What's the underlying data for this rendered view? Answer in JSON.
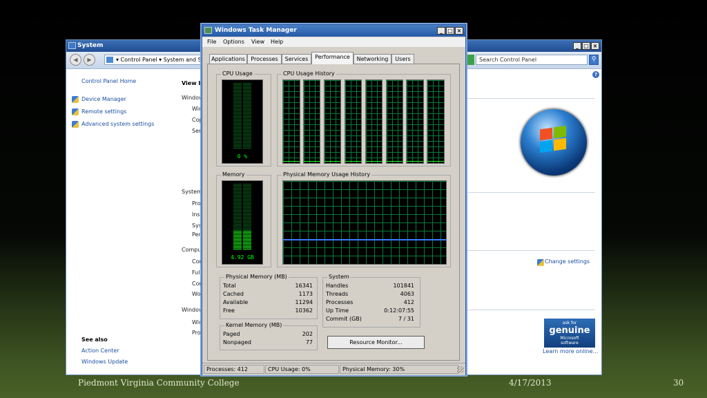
{
  "system_window": {
    "title": "System",
    "breadcrumb": "▾ Control Panel ▾ System and Se",
    "search_placeholder": "Search Control Panel",
    "sidebar": {
      "home": "Control Panel Home",
      "links": [
        "Device Manager",
        "Remote settings",
        "Advanced system settings"
      ],
      "see_also": "See also",
      "see_also_links": [
        "Action Center",
        "Windows Update"
      ]
    },
    "content": {
      "view_basic": "View ba",
      "windows_edition": "Windows",
      "edition_rows": [
        "Win",
        "Cop",
        "Serv"
      ],
      "system_section": "System",
      "system_rows": [
        "Proc",
        "Inst",
        "Syst",
        "Pen"
      ],
      "computer_section": "Compute",
      "computer_rows": [
        "Com",
        "Full",
        "Com",
        "Wor"
      ],
      "activation_section": "Windows",
      "activation_rows": [
        "Win",
        "Proc"
      ]
    },
    "change_settings": "Change settings",
    "genuine": {
      "ask": "ask for",
      "big": "genuine",
      "brand": "Microsoft",
      "sub": "software"
    },
    "learn_more": "Learn more online..."
  },
  "task_manager": {
    "title": "Windows Task Manager",
    "menu": [
      "File",
      "Options",
      "View",
      "Help"
    ],
    "tabs": [
      "Applications",
      "Processes",
      "Services",
      "Performance",
      "Networking",
      "Users"
    ],
    "active_tab": "Performance",
    "cpu_usage_label": "CPU Usage",
    "cpu_usage_value": "0 %",
    "cpu_history_label": "CPU Usage History",
    "memory_label": "Memory",
    "memory_value": "4.92 GB",
    "memory_fraction": 0.3,
    "phys_history_label": "Physical Memory Usage History",
    "physical_memory": {
      "label": "Physical Memory (MB)",
      "rows": [
        {
          "name": "Total",
          "value": "16341"
        },
        {
          "name": "Cached",
          "value": "1173"
        },
        {
          "name": "Available",
          "value": "11294"
        },
        {
          "name": "Free",
          "value": "10362"
        }
      ]
    },
    "kernel_memory": {
      "label": "Kernel Memory (MB)",
      "rows": [
        {
          "name": "Paged",
          "value": "202"
        },
        {
          "name": "Nonpaged",
          "value": "77"
        }
      ]
    },
    "system": {
      "label": "System",
      "rows": [
        {
          "name": "Handles",
          "value": "101841"
        },
        {
          "name": "Threads",
          "value": "4063"
        },
        {
          "name": "Processes",
          "value": "412"
        },
        {
          "name": "Up Time",
          "value": "0:12:07:55"
        },
        {
          "name": "Commit (GB)",
          "value": "7 / 31"
        }
      ]
    },
    "resource_monitor_button": "Resource Monitor...",
    "status": {
      "processes": "Processes: 412",
      "cpu": "CPU Usage: 0%",
      "memory": "Physical Memory: 30%"
    }
  },
  "slide_footer": {
    "college": "Piedmont Virginia Community College",
    "date": "4/17/2013",
    "page": "30"
  }
}
